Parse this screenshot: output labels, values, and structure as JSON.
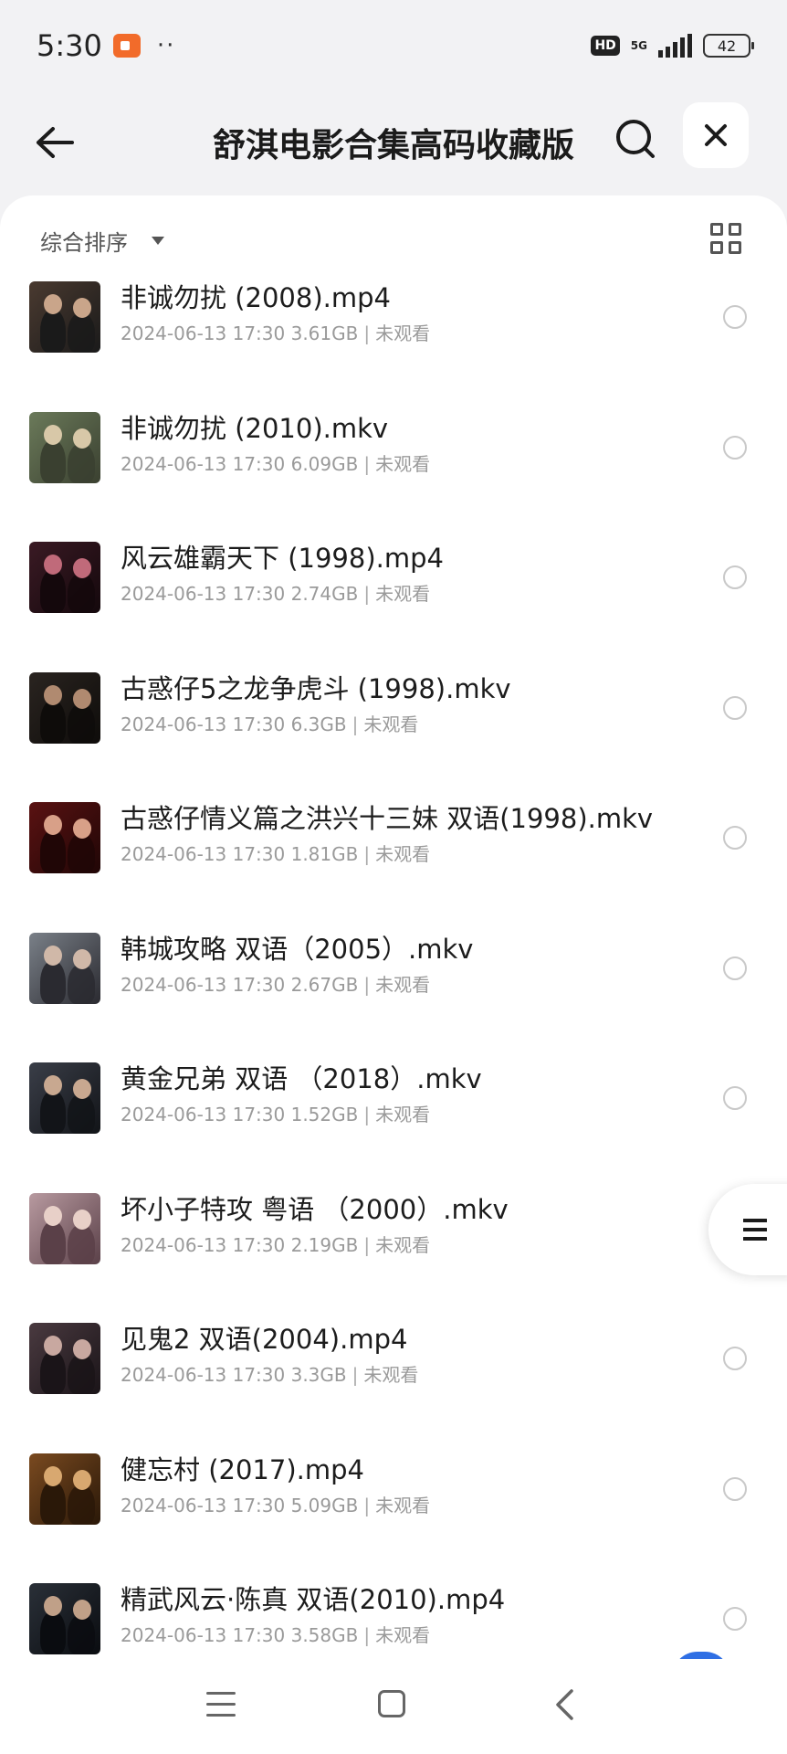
{
  "status_bar": {
    "time": "5:30",
    "dots": "··",
    "hd": "HD",
    "network": "5G",
    "battery": "42"
  },
  "header": {
    "title": "舒淇电影合集高码收藏版",
    "back_icon": "arrow-left-icon",
    "search_icon": "search-icon",
    "close_icon": "close-icon"
  },
  "toolbar": {
    "sort_label": "综合排序",
    "view_icon": "grid-view-icon"
  },
  "files": [
    {
      "name": "非诚勿扰 (2008).mp4",
      "date": "2024-06-13 17:30",
      "size": "3.61GB",
      "status": "未观看",
      "thumb_colors": [
        "#4a3a30",
        "#c9a58a",
        "#1a1a1a"
      ]
    },
    {
      "name": "非诚勿扰 (2010).mkv",
      "date": "2024-06-13 17:30",
      "size": "6.09GB",
      "status": "未观看",
      "thumb_colors": [
        "#6b7a5a",
        "#d8c8a8",
        "#3a4030"
      ]
    },
    {
      "name": "风云雄霸天下 (1998).mp4",
      "date": "2024-06-13 17:30",
      "size": "2.74GB",
      "status": "未观看",
      "thumb_colors": [
        "#3a1a24",
        "#c06a7a",
        "#14080c"
      ]
    },
    {
      "name": "古惑仔5之龙争虎斗 (1998).mkv",
      "date": "2024-06-13 17:30",
      "size": "6.3GB",
      "status": "未观看",
      "thumb_colors": [
        "#2a2420",
        "#b08a70",
        "#0e0c0a"
      ]
    },
    {
      "name": "古惑仔情义篇之洪兴十三妹 双语(1998).mkv",
      "date": "2024-06-13 17:30",
      "size": "1.81GB",
      "status": "未观看",
      "thumb_colors": [
        "#5a1212",
        "#d8a088",
        "#200606"
      ]
    },
    {
      "name": "韩城攻略 双语（2005）.mkv",
      "date": "2024-06-13 17:30",
      "size": "2.67GB",
      "status": "未观看",
      "thumb_colors": [
        "#7a8088",
        "#d0b8a8",
        "#2a2a30"
      ]
    },
    {
      "name": "黄金兄弟 双语 （2018）.mkv",
      "date": "2024-06-13 17:30",
      "size": "1.52GB",
      "status": "未观看",
      "thumb_colors": [
        "#3a3e48",
        "#c8a890",
        "#121418"
      ]
    },
    {
      "name": "坏小子特攻 粤语 （2000）.mkv",
      "date": "2024-06-13 17:30",
      "size": "2.19GB",
      "status": "未观看",
      "thumb_colors": [
        "#b89aa0",
        "#e8d0c8",
        "#5a4048"
      ]
    },
    {
      "name": "见鬼2 双语(2004).mp4",
      "date": "2024-06-13 17:30",
      "size": "3.3GB",
      "status": "未观看",
      "thumb_colors": [
        "#4a3a40",
        "#c8a8a0",
        "#1a1418"
      ]
    },
    {
      "name": "健忘村 (2017).mp4",
      "date": "2024-06-13 17:30",
      "size": "5.09GB",
      "status": "未观看",
      "thumb_colors": [
        "#7a4a20",
        "#d8a870",
        "#2a1808"
      ]
    },
    {
      "name": "精武风云·陈真 双语(2010).mp4",
      "date": "2024-06-13 17:30",
      "size": "3.58GB",
      "status": "未观看",
      "thumb_colors": [
        "#2a3038",
        "#c0a088",
        "#0a0c10"
      ]
    }
  ],
  "side_handle_icon": "menu-icon",
  "bottom_nav": {
    "menu_icon": "recents-icon",
    "home_icon": "home-icon",
    "back_icon": "back-icon"
  }
}
